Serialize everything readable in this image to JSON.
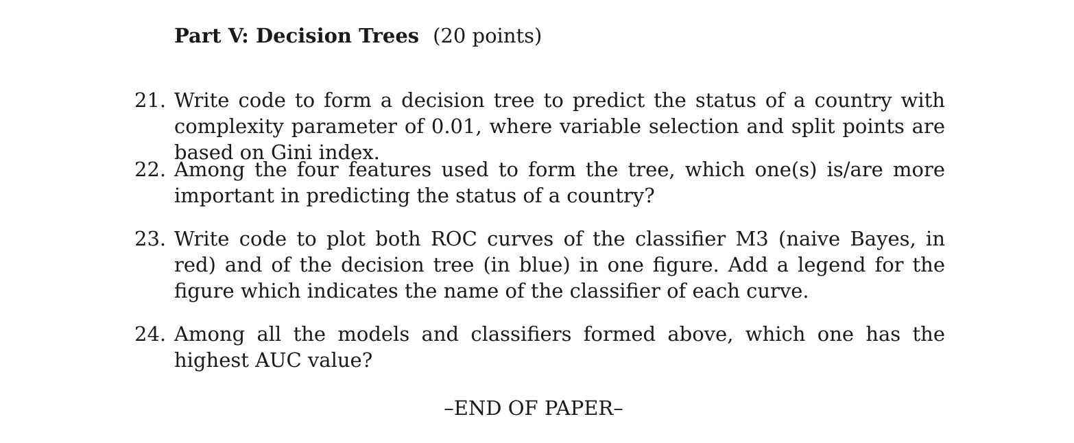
{
  "section": {
    "title": "Part V: Decision Trees",
    "points": "(20 points)"
  },
  "questions": [
    {
      "number": "21.",
      "text": "Write code to form a decision tree to predict the status of a country with complexity parameter of 0.01, where variable selection and split points are based on Gini index."
    },
    {
      "number": "22.",
      "text": "Among the four features used to form the tree, which one(s) is/are more important in predicting the status of a country?"
    },
    {
      "number": "23.",
      "text": "Write code to plot both ROC curves of the classifier M3 (naive Bayes, in red) and of the decision tree (in blue) in one figure. Add a legend for the figure which indicates the name of the classifier of each curve."
    },
    {
      "number": "24.",
      "text": "Among all the models and classifiers formed above, which one has the highest AUC value?"
    }
  ],
  "footer": {
    "end_text": "–END OF PAPER–"
  }
}
